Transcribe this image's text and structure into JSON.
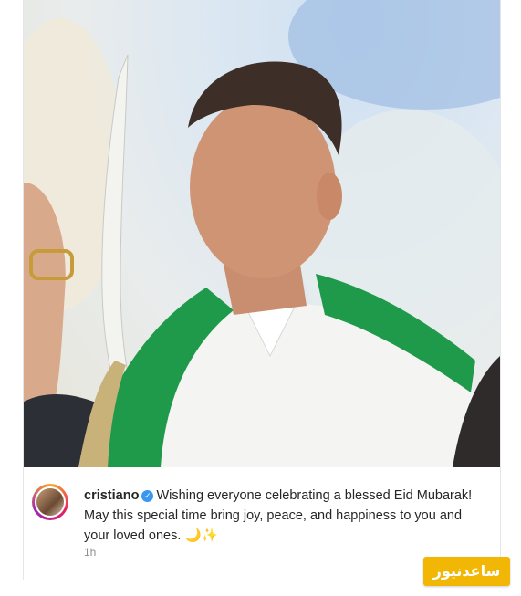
{
  "post": {
    "image_alt": "Man in white thobe with green sash holding a sword",
    "username": "cristiano",
    "caption": "Wishing everyone celebrating a blessed Eid Mubarak! May this special time bring joy, peace, and happiness to you and your loved ones.",
    "emojis": "🌙✨",
    "time": "1h"
  },
  "watermark": {
    "text": "ساعدنیوز"
  },
  "colors": {
    "accent_verified": "#3897f0",
    "watermark_bg": "#f2b705"
  }
}
